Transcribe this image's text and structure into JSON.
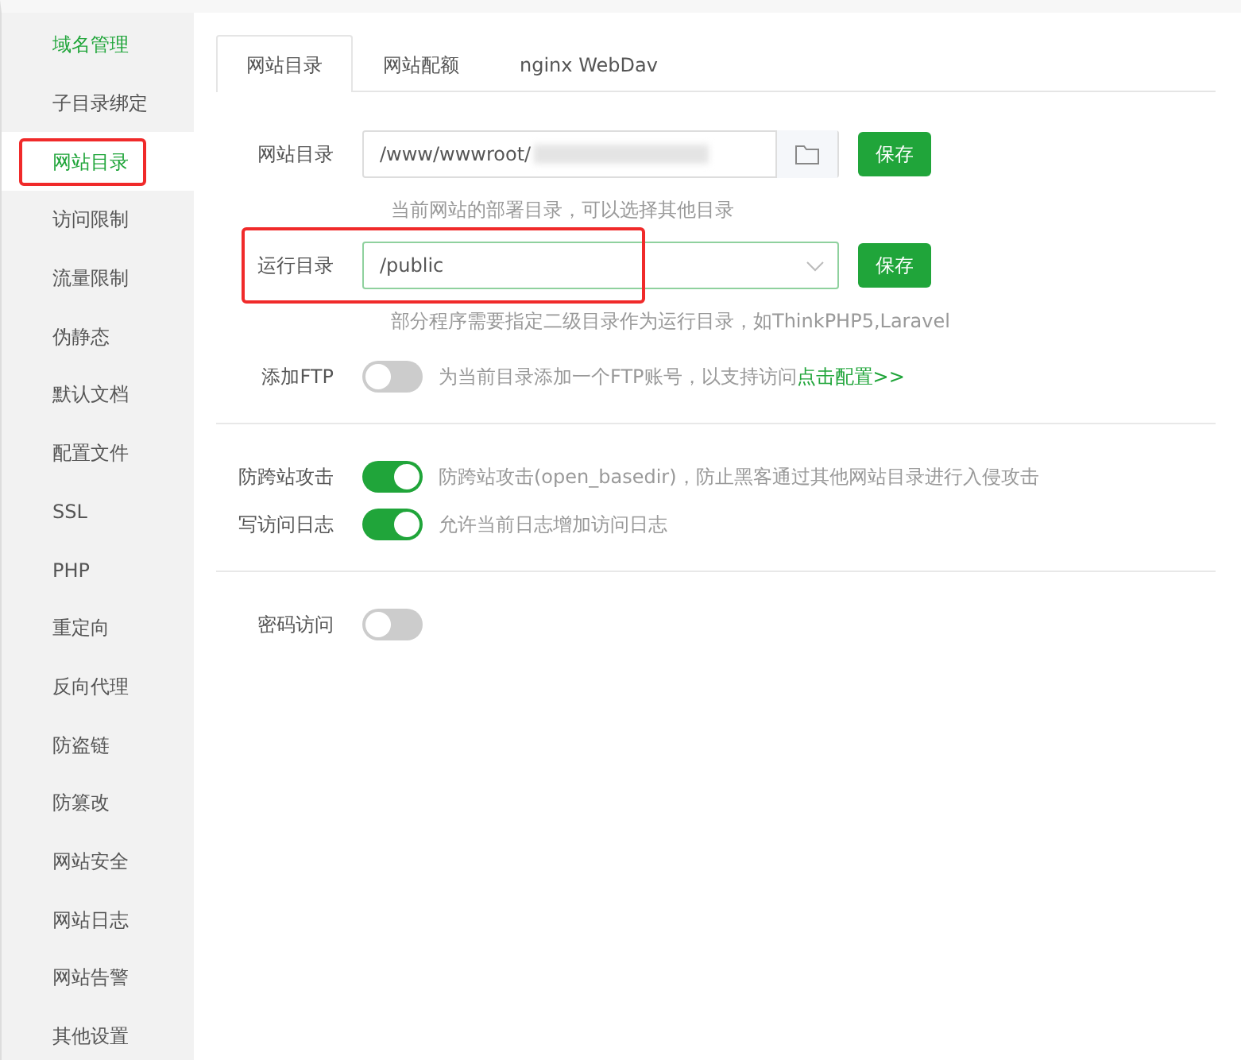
{
  "sidebar": {
    "items": [
      {
        "label": "域名管理",
        "selected": false,
        "accent": true,
        "highlighted": false
      },
      {
        "label": "子目录绑定",
        "selected": false,
        "accent": false,
        "highlighted": false
      },
      {
        "label": "网站目录",
        "selected": true,
        "accent": true,
        "highlighted": true
      },
      {
        "label": "访问限制",
        "selected": false,
        "accent": false,
        "highlighted": false
      },
      {
        "label": "流量限制",
        "selected": false,
        "accent": false,
        "highlighted": false
      },
      {
        "label": "伪静态",
        "selected": false,
        "accent": false,
        "highlighted": false
      },
      {
        "label": "默认文档",
        "selected": false,
        "accent": false,
        "highlighted": false
      },
      {
        "label": "配置文件",
        "selected": false,
        "accent": false,
        "highlighted": false
      },
      {
        "label": "SSL",
        "selected": false,
        "accent": false,
        "highlighted": false
      },
      {
        "label": "PHP",
        "selected": false,
        "accent": false,
        "highlighted": false
      },
      {
        "label": "重定向",
        "selected": false,
        "accent": false,
        "highlighted": false
      },
      {
        "label": "反向代理",
        "selected": false,
        "accent": false,
        "highlighted": false
      },
      {
        "label": "防盗链",
        "selected": false,
        "accent": false,
        "highlighted": false
      },
      {
        "label": "防篡改",
        "selected": false,
        "accent": false,
        "highlighted": false
      },
      {
        "label": "网站安全",
        "selected": false,
        "accent": false,
        "highlighted": false
      },
      {
        "label": "网站日志",
        "selected": false,
        "accent": false,
        "highlighted": false
      },
      {
        "label": "网站告警",
        "selected": false,
        "accent": false,
        "highlighted": false
      },
      {
        "label": "其他设置",
        "selected": false,
        "accent": false,
        "highlighted": false
      }
    ]
  },
  "tabs": [
    {
      "label": "网站目录",
      "selected": true
    },
    {
      "label": "网站配额",
      "selected": false
    },
    {
      "label": "nginx WebDav",
      "selected": false
    }
  ],
  "sections": [
    [
      {
        "kind": "path",
        "label": "网站目录",
        "value": "/www/wwwroot/",
        "button": "保存",
        "hint": "当前网站的部署目录，可以选择其他目录",
        "highlighted": false
      },
      {
        "kind": "select",
        "label": "运行目录",
        "value": "/public",
        "button": "保存",
        "hint": "部分程序需要指定二级目录作为运行目录，如ThinkPHP5,Laravel",
        "highlighted": true
      },
      {
        "kind": "toggle",
        "label": "添加FTP",
        "on": false,
        "description": "为当前目录添加一个FTP账号，以支持访问",
        "link": "点击配置>>"
      }
    ],
    [
      {
        "kind": "toggle",
        "label": "防跨站攻击",
        "on": true,
        "description": "防跨站攻击(open_basedir)，防止黑客通过其他网站目录进行入侵攻击"
      },
      {
        "kind": "toggle",
        "label": "写访问日志",
        "on": true,
        "description": "允许当前日志增加访问日志"
      }
    ],
    [
      {
        "kind": "toggle",
        "label": "密码访问",
        "on": false
      }
    ]
  ]
}
